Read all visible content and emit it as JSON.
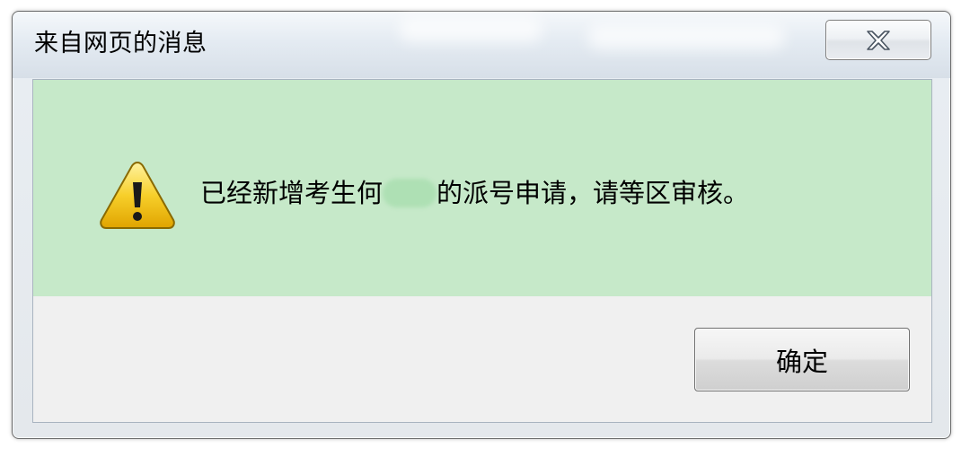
{
  "dialog": {
    "title": "来自网页的消息",
    "close_icon": "close-x-icon",
    "message": {
      "prefix": "已经新增考生何",
      "suffix": "的派号申请，请等区审核。"
    },
    "icon": "warning-triangle-icon",
    "ok_label": "确定"
  },
  "colors": {
    "message_background": "#c6e9c9",
    "button_area_background": "#f0f0f0",
    "warning_yellow": "#f5c518"
  }
}
